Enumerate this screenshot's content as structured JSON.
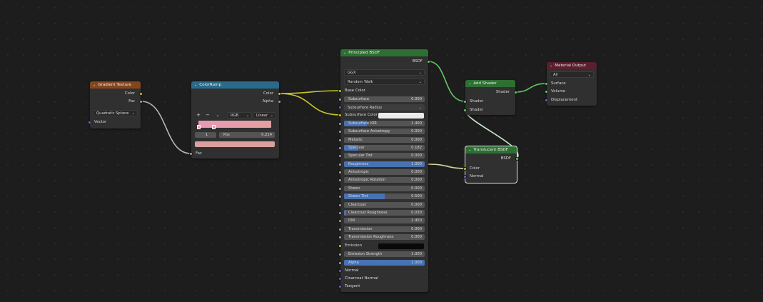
{
  "nodes": {
    "gradient_texture": {
      "title": "Gradient Texture",
      "outputs": [
        "Color",
        "Fac"
      ],
      "type_value": "Quadratic Sphere",
      "inputs": [
        "Vector"
      ]
    },
    "color_ramp": {
      "title": "ColorRamp",
      "outputs": [
        "Color",
        "Alpha"
      ],
      "add_label": "+",
      "remove_label": "−",
      "menu_label": "⌄",
      "color_mode": "RGB",
      "interpolation": "Linear",
      "stop_index": "1",
      "pos_label": "Pos",
      "pos_value": "0.214",
      "inputs": [
        "Fac"
      ],
      "colors": {
        "ramp_start": "#e89ab4",
        "ramp_end": "#e2a0a0",
        "selected_stop": "#d9a09e"
      }
    },
    "principled_bsdf": {
      "title": "Principled BSDF",
      "output": "BSDF",
      "distribution": "GGX",
      "subsurface_method": "Random Walk",
      "base_color_label": "Base Color",
      "subsurface_label": "Subsurface",
      "subsurface_value": "0.000",
      "subsurface_radius_label": "Subsurface Radius",
      "subsurface_color_label": "Subsurface Color",
      "fields": [
        {
          "label": "Subsurface IOR",
          "value": "1.400",
          "fill": 0.28
        },
        {
          "label": "Subsurface Anisotropy",
          "value": "0.000",
          "fill": 0
        },
        {
          "label": "Metallic",
          "value": "0.000",
          "fill": 0
        },
        {
          "label": "Specular",
          "value": "0.182",
          "fill": 0.18
        },
        {
          "label": "Specular Tint",
          "value": "0.000",
          "fill": 0
        },
        {
          "label": "Roughness",
          "value": "1.000",
          "fill": 1
        },
        {
          "label": "Anisotropic",
          "value": "0.000",
          "fill": 0
        },
        {
          "label": "Anisotropic Rotation",
          "value": "0.000",
          "fill": 0
        },
        {
          "label": "Sheen",
          "value": "0.000",
          "fill": 0
        },
        {
          "label": "Sheen Tint",
          "value": "0.500",
          "fill": 0.5
        },
        {
          "label": "Clearcoat",
          "value": "0.000",
          "fill": 0
        },
        {
          "label": "Clearcoat Roughness",
          "value": "0.030",
          "fill": 0.03
        },
        {
          "label": "IOR",
          "value": "1.450",
          "fill": 0
        },
        {
          "label": "Transmission",
          "value": "0.000",
          "fill": 0
        },
        {
          "label": "Transmission Roughness",
          "value": "0.000",
          "fill": 0
        }
      ],
      "emission_label": "Emission",
      "emission_strength_label": "Emission Strength",
      "emission_strength_value": "1.000",
      "alpha_label": "Alpha",
      "alpha_value": "1.000",
      "normal_label": "Normal",
      "clearcoat_normal_label": "Clearcoat Normal",
      "tangent_label": "Tangent"
    },
    "add_shader": {
      "title": "Add Shader",
      "output": "Shader",
      "inputs": [
        "Shader",
        "Shader"
      ]
    },
    "material_output": {
      "title": "Material Output",
      "target": "All",
      "inputs": [
        "Surface",
        "Volume",
        "Displacement"
      ]
    },
    "translucent_bsdf": {
      "title": "Translucent BSDF",
      "output": "BSDF",
      "inputs": [
        "Color",
        "Normal"
      ]
    }
  },
  "colors": {
    "header_texture": "#83461e",
    "header_converter": "#2a6a8b",
    "header_shader": "#2e6f32",
    "header_output": "#5a1e2c",
    "socket_color": "#c7c729",
    "socket_shader": "#63c763",
    "socket_value": "#a1a1a1",
    "socket_vector": "#6363c7",
    "field_fill": "#4772b3"
  }
}
